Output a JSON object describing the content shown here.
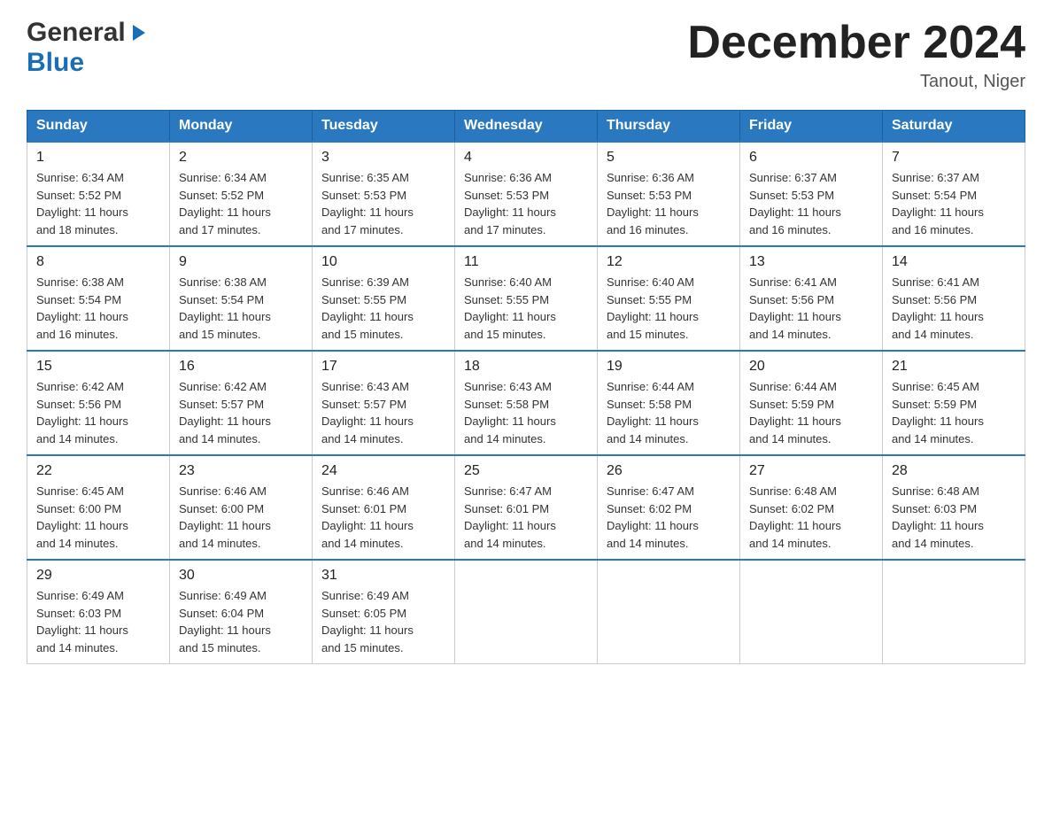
{
  "header": {
    "logo": {
      "general": "General",
      "blue": "Blue"
    },
    "title": "December 2024",
    "location": "Tanout, Niger"
  },
  "days_of_week": [
    "Sunday",
    "Monday",
    "Tuesday",
    "Wednesday",
    "Thursday",
    "Friday",
    "Saturday"
  ],
  "weeks": [
    [
      {
        "day": "1",
        "sunrise": "6:34 AM",
        "sunset": "5:52 PM",
        "daylight": "11 hours and 18 minutes."
      },
      {
        "day": "2",
        "sunrise": "6:34 AM",
        "sunset": "5:52 PM",
        "daylight": "11 hours and 17 minutes."
      },
      {
        "day": "3",
        "sunrise": "6:35 AM",
        "sunset": "5:53 PM",
        "daylight": "11 hours and 17 minutes."
      },
      {
        "day": "4",
        "sunrise": "6:36 AM",
        "sunset": "5:53 PM",
        "daylight": "11 hours and 17 minutes."
      },
      {
        "day": "5",
        "sunrise": "6:36 AM",
        "sunset": "5:53 PM",
        "daylight": "11 hours and 16 minutes."
      },
      {
        "day": "6",
        "sunrise": "6:37 AM",
        "sunset": "5:53 PM",
        "daylight": "11 hours and 16 minutes."
      },
      {
        "day": "7",
        "sunrise": "6:37 AM",
        "sunset": "5:54 PM",
        "daylight": "11 hours and 16 minutes."
      }
    ],
    [
      {
        "day": "8",
        "sunrise": "6:38 AM",
        "sunset": "5:54 PM",
        "daylight": "11 hours and 16 minutes."
      },
      {
        "day": "9",
        "sunrise": "6:38 AM",
        "sunset": "5:54 PM",
        "daylight": "11 hours and 15 minutes."
      },
      {
        "day": "10",
        "sunrise": "6:39 AM",
        "sunset": "5:55 PM",
        "daylight": "11 hours and 15 minutes."
      },
      {
        "day": "11",
        "sunrise": "6:40 AM",
        "sunset": "5:55 PM",
        "daylight": "11 hours and 15 minutes."
      },
      {
        "day": "12",
        "sunrise": "6:40 AM",
        "sunset": "5:55 PM",
        "daylight": "11 hours and 15 minutes."
      },
      {
        "day": "13",
        "sunrise": "6:41 AM",
        "sunset": "5:56 PM",
        "daylight": "11 hours and 14 minutes."
      },
      {
        "day": "14",
        "sunrise": "6:41 AM",
        "sunset": "5:56 PM",
        "daylight": "11 hours and 14 minutes."
      }
    ],
    [
      {
        "day": "15",
        "sunrise": "6:42 AM",
        "sunset": "5:56 PM",
        "daylight": "11 hours and 14 minutes."
      },
      {
        "day": "16",
        "sunrise": "6:42 AM",
        "sunset": "5:57 PM",
        "daylight": "11 hours and 14 minutes."
      },
      {
        "day": "17",
        "sunrise": "6:43 AM",
        "sunset": "5:57 PM",
        "daylight": "11 hours and 14 minutes."
      },
      {
        "day": "18",
        "sunrise": "6:43 AM",
        "sunset": "5:58 PM",
        "daylight": "11 hours and 14 minutes."
      },
      {
        "day": "19",
        "sunrise": "6:44 AM",
        "sunset": "5:58 PM",
        "daylight": "11 hours and 14 minutes."
      },
      {
        "day": "20",
        "sunrise": "6:44 AM",
        "sunset": "5:59 PM",
        "daylight": "11 hours and 14 minutes."
      },
      {
        "day": "21",
        "sunrise": "6:45 AM",
        "sunset": "5:59 PM",
        "daylight": "11 hours and 14 minutes."
      }
    ],
    [
      {
        "day": "22",
        "sunrise": "6:45 AM",
        "sunset": "6:00 PM",
        "daylight": "11 hours and 14 minutes."
      },
      {
        "day": "23",
        "sunrise": "6:46 AM",
        "sunset": "6:00 PM",
        "daylight": "11 hours and 14 minutes."
      },
      {
        "day": "24",
        "sunrise": "6:46 AM",
        "sunset": "6:01 PM",
        "daylight": "11 hours and 14 minutes."
      },
      {
        "day": "25",
        "sunrise": "6:47 AM",
        "sunset": "6:01 PM",
        "daylight": "11 hours and 14 minutes."
      },
      {
        "day": "26",
        "sunrise": "6:47 AM",
        "sunset": "6:02 PM",
        "daylight": "11 hours and 14 minutes."
      },
      {
        "day": "27",
        "sunrise": "6:48 AM",
        "sunset": "6:02 PM",
        "daylight": "11 hours and 14 minutes."
      },
      {
        "day": "28",
        "sunrise": "6:48 AM",
        "sunset": "6:03 PM",
        "daylight": "11 hours and 14 minutes."
      }
    ],
    [
      {
        "day": "29",
        "sunrise": "6:49 AM",
        "sunset": "6:03 PM",
        "daylight": "11 hours and 14 minutes."
      },
      {
        "day": "30",
        "sunrise": "6:49 AM",
        "sunset": "6:04 PM",
        "daylight": "11 hours and 15 minutes."
      },
      {
        "day": "31",
        "sunrise": "6:49 AM",
        "sunset": "6:05 PM",
        "daylight": "11 hours and 15 minutes."
      },
      null,
      null,
      null,
      null
    ]
  ],
  "labels": {
    "sunrise": "Sunrise:",
    "sunset": "Sunset:",
    "daylight": "Daylight:"
  }
}
